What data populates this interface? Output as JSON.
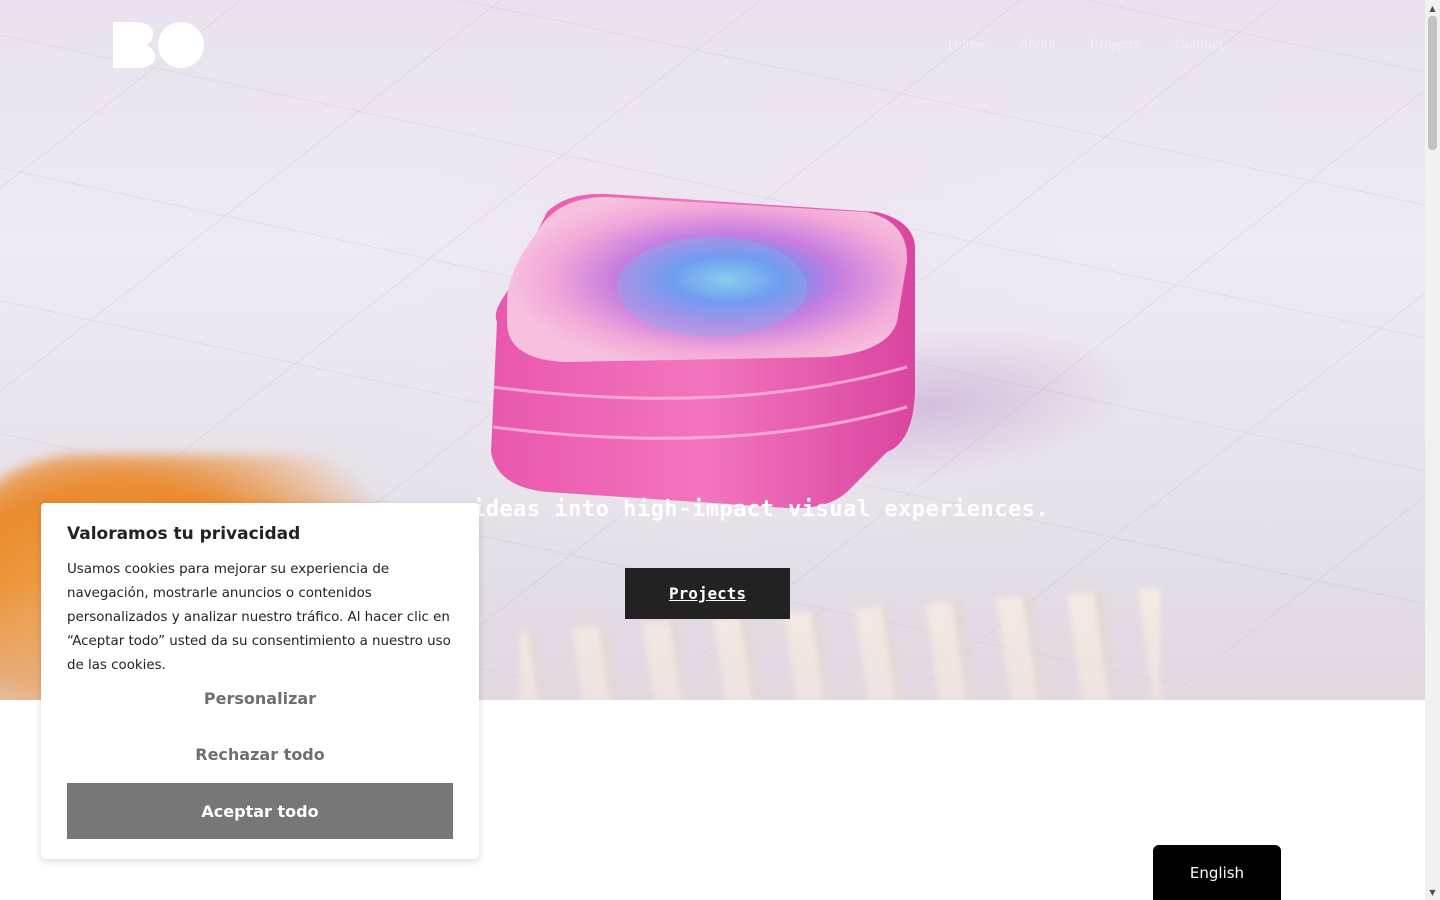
{
  "header": {
    "logo_text": "BO",
    "nav": [
      "Home",
      "About",
      "Projects",
      "Contact"
    ]
  },
  "hero": {
    "tagline": "n your ideas into high-impact visual experiences.",
    "projects_button": "Projects"
  },
  "cookie_banner": {
    "title": "Valoramos tu privacidad",
    "text": "Usamos cookies para mejorar su experiencia de navegación, mostrarle anuncios o contenidos personalizados y analizar nuestro tráfico. Al hacer clic en “Aceptar todo” usted da su consentimiento a nuestro uso de las cookies.",
    "personalize_label": "Personalizar",
    "reject_label": "Rechazar todo",
    "accept_label": "Aceptar todo"
  },
  "language_button": "English",
  "colors": {
    "button_dark": "#222222",
    "accept_gray": "#777777",
    "secondary_text": "#6f6f6f",
    "lang_bg": "#000000"
  },
  "icons": [
    "logo-icon",
    "scroll-up-arrow-icon",
    "scroll-down-arrow-icon"
  ]
}
